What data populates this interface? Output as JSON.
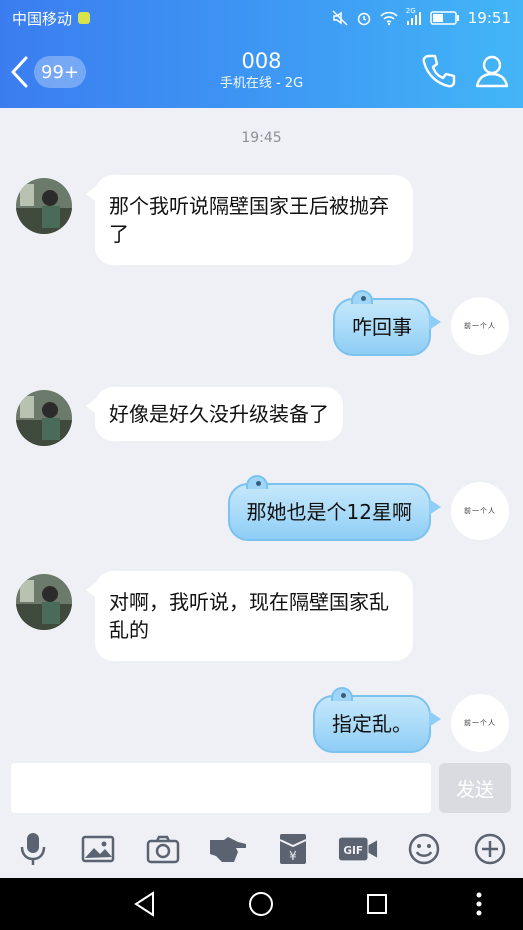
{
  "status_bar": {
    "carrier": "中国移动",
    "network": "2G",
    "time": "19:51"
  },
  "header": {
    "back_badge": "99+",
    "contact_name": "008",
    "contact_status": "手机在线 - 2G"
  },
  "chat": {
    "timestamp": "19:45",
    "my_avatar_text": "前一个人",
    "messages": [
      {
        "from": "other",
        "text": "那个我听说隔壁国家王后被抛弃了"
      },
      {
        "from": "me",
        "text": "咋回事"
      },
      {
        "from": "other",
        "text": "好像是好久没升级装备了"
      },
      {
        "from": "me",
        "text": "那她也是个12星啊"
      },
      {
        "from": "other",
        "text": "对啊，我听说，现在隔壁国家乱乱的"
      },
      {
        "from": "me",
        "text": "指定乱。"
      }
    ]
  },
  "input": {
    "placeholder": "",
    "send_label": "发送"
  },
  "toolbar": {
    "icons": [
      "microphone-icon",
      "image-icon",
      "camera-icon",
      "poke-icon",
      "red-packet-icon",
      "gif-icon",
      "emoji-icon",
      "plus-icon"
    ]
  },
  "colors": {
    "header_start": "#3b7df0",
    "header_end": "#43b6f7",
    "incoming_bubble": "#ffffff",
    "outgoing_bubble": "#a8daf8",
    "chat_bg": "#eef0f5"
  }
}
